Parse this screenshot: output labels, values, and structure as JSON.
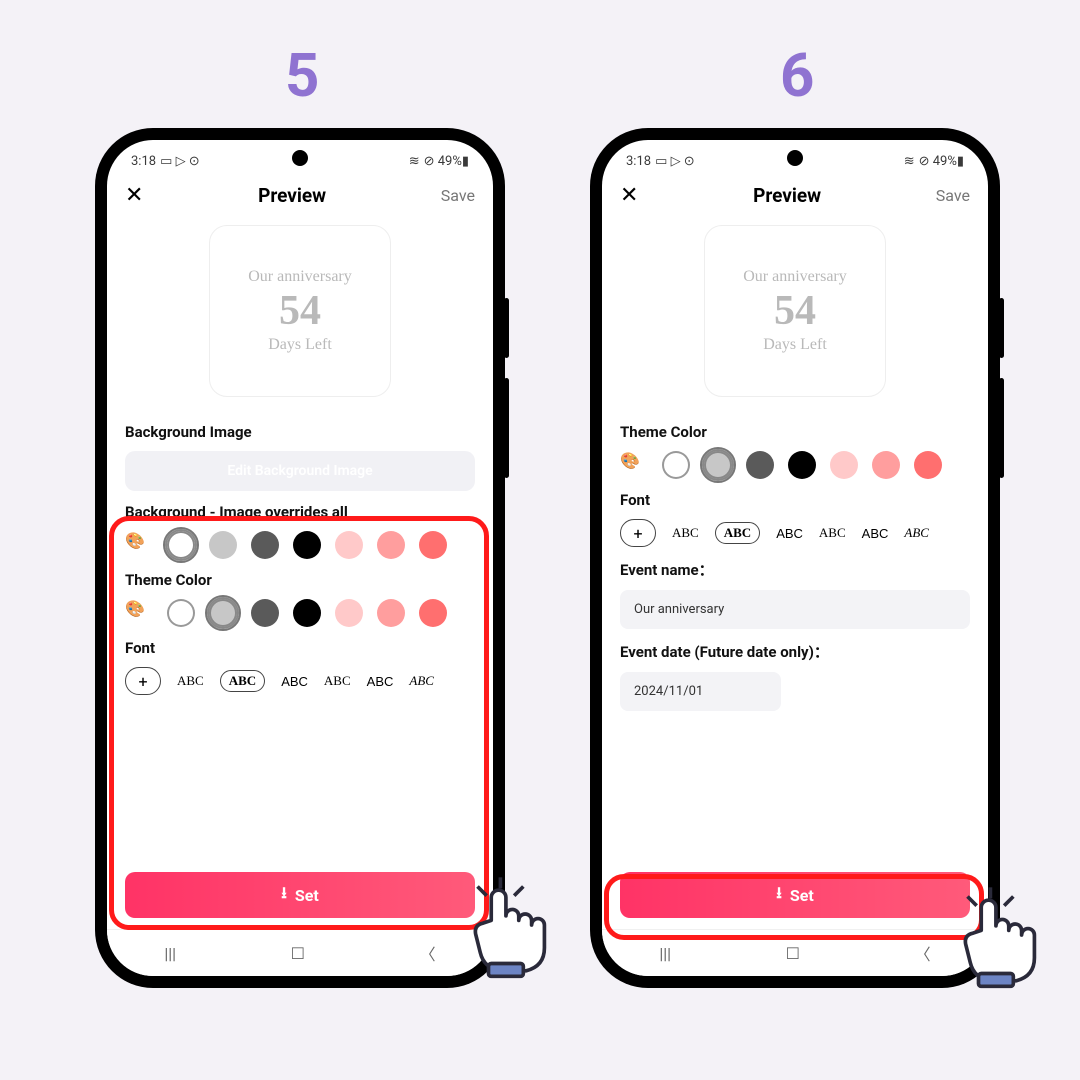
{
  "steps": [
    "5",
    "6"
  ],
  "status": {
    "time": "3:18",
    "icons_left": "▭ ▷ ⊙",
    "icons_right": "⊘ 49%▮",
    "wifi": "≋"
  },
  "topbar": {
    "title": "Preview",
    "save": "Save"
  },
  "preview": {
    "line1": "Our anniversary",
    "count": "54",
    "line2": "Days Left"
  },
  "left": {
    "bg_image_label": "Background Image",
    "edit_btn": "Edit Background Image",
    "bg_label": "Background - Image overrides all",
    "theme_label": "Theme Color",
    "font_label": "Font"
  },
  "right": {
    "theme_label": "Theme Color",
    "font_label": "Font",
    "event_name_label": "Event name：",
    "event_name_value": "Our anniversary",
    "event_date_label": "Event date (Future date only)：",
    "event_date_value": "2024/11/01"
  },
  "colors": {
    "swatches": [
      "#ffffff",
      "#c7c7c7",
      "#5a5a5a",
      "#000000",
      "#ffc9c9",
      "#ff9e9e",
      "#ff6f6f"
    ]
  },
  "fonts": [
    "ABC",
    "ABC",
    "ABC",
    "ABC",
    "ABC",
    "ABC"
  ],
  "set_btn": "Set",
  "nav": [
    "|||",
    "☐",
    "〈"
  ]
}
